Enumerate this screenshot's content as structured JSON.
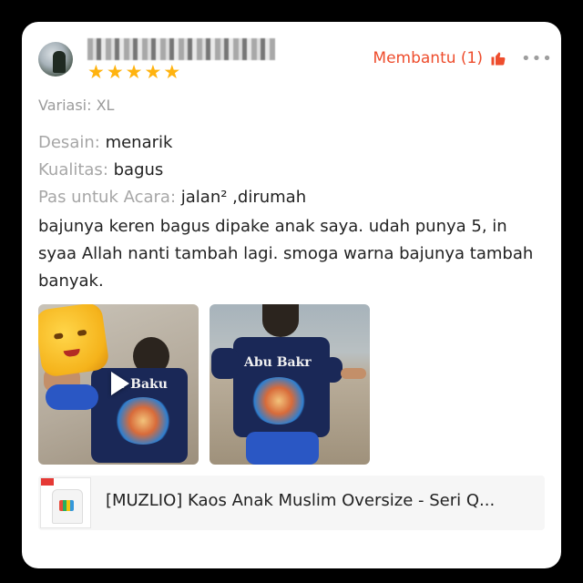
{
  "reviewer": {
    "rating": 5,
    "stars": [
      "★",
      "★",
      "★",
      "★",
      "★"
    ]
  },
  "helpful": {
    "label": "Membantu (1)",
    "icon": "thumbs-up-icon",
    "color": "#ee4d2d"
  },
  "more": {
    "label": "•••",
    "icon": "more-icon"
  },
  "variation": "Variasi: XL",
  "attributes": [
    {
      "label": "Desain:",
      "value": "menarik"
    },
    {
      "label": "Kualitas:",
      "value": "bagus"
    },
    {
      "label": "Pas untuk Acara:",
      "value": "jalan² ,dirumah"
    }
  ],
  "review_text": "bajunya keren bagus dipake anak saya. udah punya 5, in syaa Allah nanti tambah lagi. smoga warna bajunya tambah banyak.",
  "media": [
    {
      "type": "video",
      "shirt_text": "er Baku"
    },
    {
      "type": "image",
      "shirt_text": "Abu Bakr"
    }
  ],
  "product": {
    "name": "[MUZLIO] Kaos Anak Muslim Oversize - Seri Q..."
  },
  "colors": {
    "star": "#ffb30f",
    "accent": "#ee4d2d"
  }
}
